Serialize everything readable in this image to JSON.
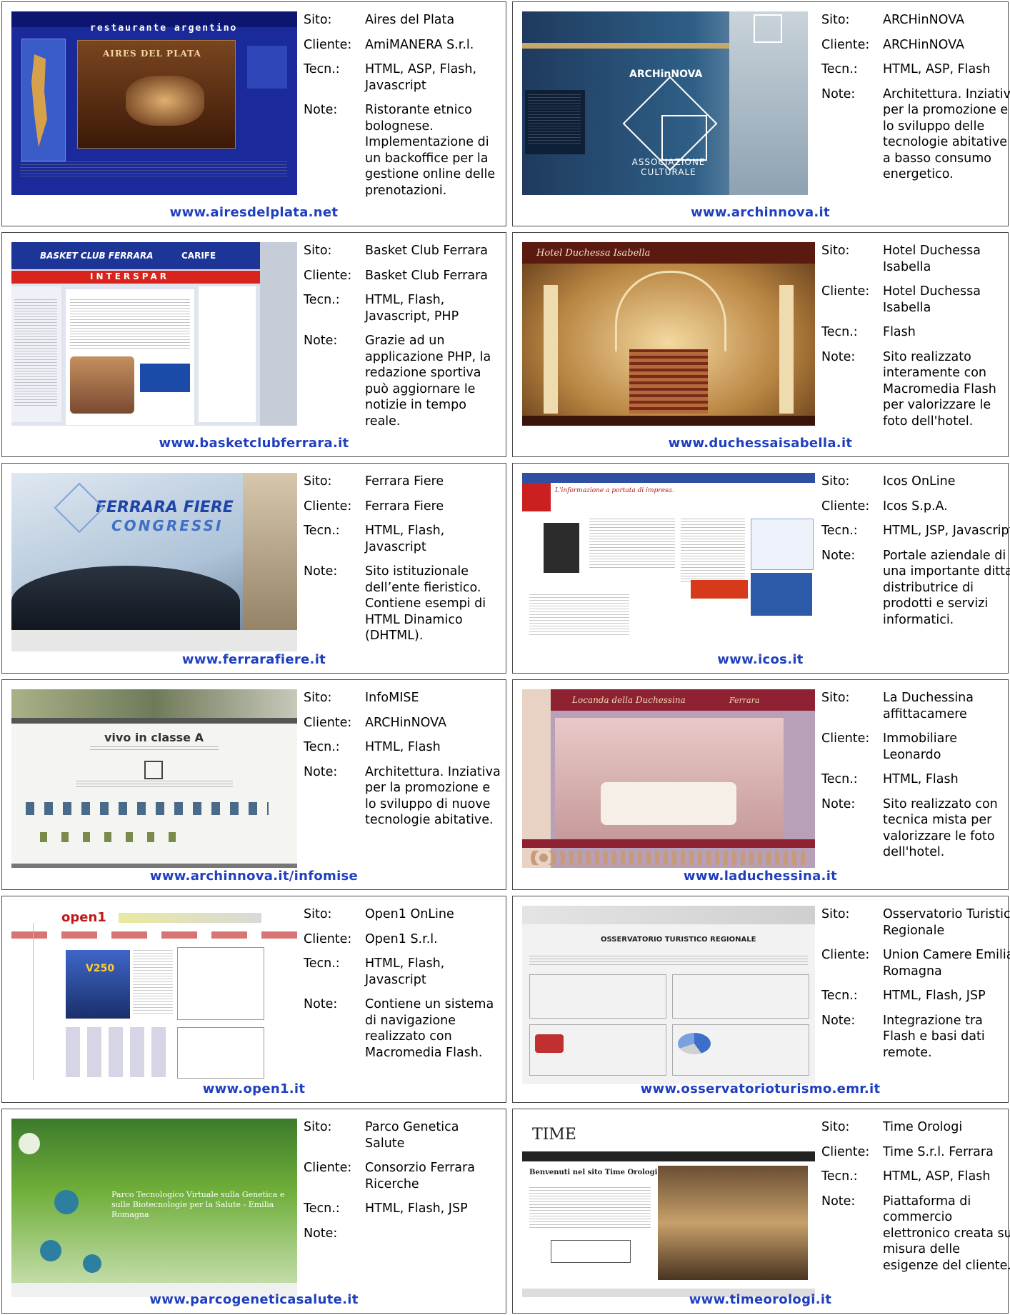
{
  "labels": {
    "site": "Sito:",
    "client": "Cliente:",
    "tech": "Tecn.:",
    "notes": "Note:"
  },
  "cards": [
    {
      "site": "Aires del Plata",
      "client": "AmiMANERA S.r.l.",
      "tech": "HTML, ASP, Flash, Javascript",
      "notes": "Ristorante etnico bolognese. Implementazione di un backoffice per la gestione online delle prenotazioni.",
      "url": "www.airesdelplata.net",
      "thumb_title": "restaurante argentino",
      "thumb_sign": "AIRES DEL PLATA"
    },
    {
      "site": "ARCHinNOVA",
      "client": "ARCHinNOVA",
      "tech": "HTML, ASP, Flash",
      "notes": "Architettura. Inziativa per la promozione e lo sviluppo delle tecnologie abitative a basso consumo energetico.",
      "url": "www.archinnova.it",
      "thumb_title": "ARCHinNOVA",
      "thumb_sub": "ASSOCIAZIONE CULTURALE"
    },
    {
      "site": "Basket Club Ferrara",
      "client": "Basket Club Ferrara",
      "tech": "HTML, Flash, Javascript, PHP",
      "notes": "Grazie ad un applicazione PHP, la redazione sportiva può aggiornare le notizie in tempo reale.",
      "url": "www.basketclubferrara.it",
      "thumb_title": "BASKET CLUB FERRARA",
      "thumb_sub": "INTERSPAR",
      "thumb_brand": "CARIFE"
    },
    {
      "site": "Hotel Duchessa Isabella",
      "client": "Hotel Duchessa Isabella",
      "tech": "Flash",
      "notes": "Sito realizzato interamente con Macromedia Flash per valorizzare le foto dell'hotel.",
      "url": "www.duchessaisabella.it",
      "thumb_title": "Hotel Duchessa Isabella"
    },
    {
      "site": "Ferrara Fiere",
      "client": "Ferrara Fiere",
      "tech": "HTML, Flash, Javascript",
      "notes": "Sito istituzionale dell’ente fieristico. Contiene esempi di HTML Dinamico (DHTML).",
      "url": "www.ferrarafiere.it",
      "thumb_title": "FERRARA FIERE",
      "thumb_sub": "CONGRESSI"
    },
    {
      "site": "Icos OnLine",
      "client": "Icos S.p.A.",
      "tech": "HTML, JSP, Javascript",
      "notes": "Portale aziendale di una importante ditta distributrice di prodotti e servizi informatici.",
      "url": "www.icos.it",
      "thumb_title": "L'informazione a portata di impresa."
    },
    {
      "site": "InfoMISE",
      "client": "ARCHinNOVA",
      "tech": "HTML, Flash",
      "notes": "Architettura. Inziativa per la promozione e lo sviluppo di nuove tecnologie abitative.",
      "url": "www.archinnova.it/infomise",
      "thumb_title": "vivo in classe A"
    },
    {
      "site": "La Duchessina affittacamere",
      "client": "Immobiliare Leonardo",
      "tech": "HTML, Flash",
      "notes": "Sito realizzato con tecnica mista per valorizzare le foto dell'hotel.",
      "url": "www.laduchessina.it",
      "thumb_title": "Locanda della Duchessina",
      "thumb_sub": "Ferrara"
    },
    {
      "site": "Open1 OnLine",
      "client": "Open1 S.r.l.",
      "tech": "HTML, Flash, Javascript",
      "notes": "Contiene un sistema di navigazione realizzato con Macromedia Flash.",
      "url": "www.open1.it",
      "thumb_title": "open1",
      "thumb_sub": "V250"
    },
    {
      "site": "Osservatorio Turistico Regionale",
      "client": "Union Camere Emilia-Romagna",
      "tech": "HTML, Flash, JSP",
      "notes": "Integrazione tra Flash e basi dati remote.",
      "url": "www.osservatorioturismo.emr.it",
      "thumb_title": "OSSERVATORIO TURISTICO REGIONALE"
    },
    {
      "site": "Parco Genetica Salute",
      "client": "Consorzio Ferrara Ricerche",
      "tech": "HTML, Flash, JSP",
      "notes": "",
      "url": "www.parcogeneticasalute.it",
      "thumb_title": "Parco Tecnologico Virtuale sulla Genetica e sulle Biotecnologie per la Salute - Emilia Romagna"
    },
    {
      "site": "Time Orologi",
      "client": "Time S.r.l. Ferrara",
      "tech": "HTML, ASP, Flash",
      "notes": "Piattaforma di commercio elettronico creata su misura delle esigenze del cliente.",
      "url": "www.timeorologi.it",
      "thumb_title": "TIME",
      "thumb_sub": "Benvenuti nel sito Time Orologi"
    }
  ],
  "colors": {
    "border": "#4a4a4a",
    "link": "#1f3fbf"
  }
}
